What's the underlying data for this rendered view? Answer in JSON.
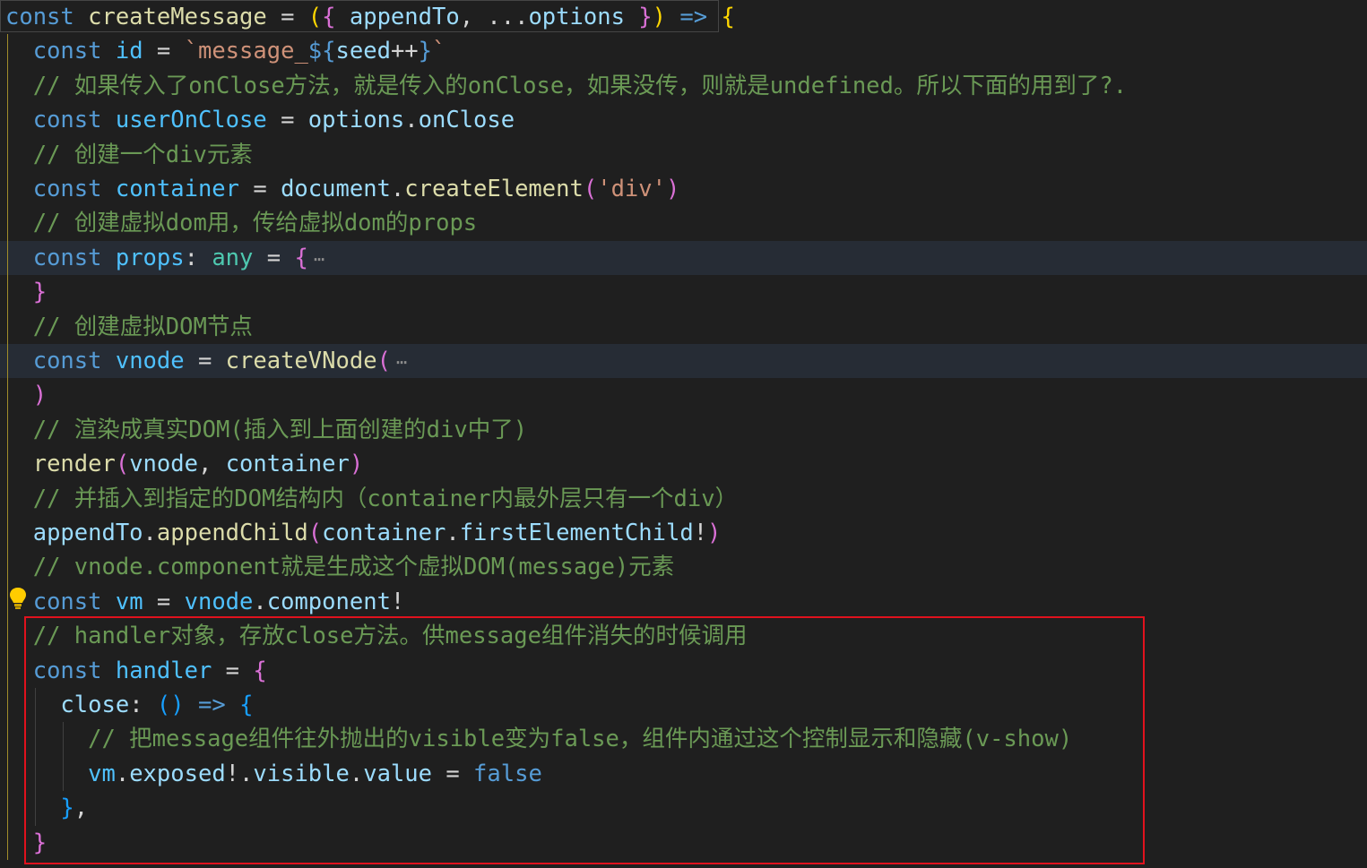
{
  "editor": {
    "lines": [
      {
        "tokens": [
          [
            "kw",
            "const"
          ],
          [
            "pun",
            " "
          ],
          [
            "fn",
            "createMessage"
          ],
          [
            "pun",
            " = "
          ],
          [
            "b1",
            "("
          ],
          [
            "b2",
            "{"
          ],
          [
            "pun",
            " "
          ],
          [
            "var",
            "appendTo"
          ],
          [
            "pun",
            ", ..."
          ],
          [
            "var",
            "options"
          ],
          [
            "pun",
            " "
          ],
          [
            "b2",
            "}"
          ],
          [
            "b1",
            ")"
          ],
          [
            "pun",
            " "
          ],
          [
            "kw",
            "=>"
          ],
          [
            "pun",
            " "
          ],
          [
            "b1",
            "{"
          ]
        ]
      },
      {
        "tokens": [
          [
            "pun",
            "  "
          ],
          [
            "kw",
            "const"
          ],
          [
            "pun",
            " "
          ],
          [
            "cst",
            "id"
          ],
          [
            "pun",
            " = "
          ],
          [
            "str",
            "`message_"
          ],
          [
            "kw",
            "${"
          ],
          [
            "var",
            "seed"
          ],
          [
            "pun",
            "++"
          ],
          [
            "kw",
            "}"
          ],
          [
            "str",
            "`"
          ]
        ]
      },
      {
        "tokens": [
          [
            "pun",
            "  "
          ],
          [
            "cmt",
            "// 如果传入了onClose方法，就是传入的onClose，如果没传，则就是undefined。所以下面的用到了?."
          ]
        ]
      },
      {
        "tokens": [
          [
            "pun",
            "  "
          ],
          [
            "kw",
            "const"
          ],
          [
            "pun",
            " "
          ],
          [
            "cst",
            "userOnClose"
          ],
          [
            "pun",
            " = "
          ],
          [
            "var",
            "options"
          ],
          [
            "pun",
            "."
          ],
          [
            "var",
            "onClose"
          ]
        ]
      },
      {
        "tokens": [
          [
            "pun",
            "  "
          ],
          [
            "cmt",
            "// 创建一个div元素"
          ]
        ]
      },
      {
        "tokens": [
          [
            "pun",
            "  "
          ],
          [
            "kw",
            "const"
          ],
          [
            "pun",
            " "
          ],
          [
            "cst",
            "container"
          ],
          [
            "pun",
            " = "
          ],
          [
            "var",
            "document"
          ],
          [
            "pun",
            "."
          ],
          [
            "fn",
            "createElement"
          ],
          [
            "b2",
            "("
          ],
          [
            "str",
            "'div'"
          ],
          [
            "b2",
            ")"
          ]
        ]
      },
      {
        "tokens": [
          [
            "pun",
            "  "
          ],
          [
            "cmt",
            "// 创建虚拟dom用，传给虚拟dom的props"
          ]
        ]
      },
      {
        "highlight": true,
        "fold": "⋯",
        "tokens": [
          [
            "pun",
            "  "
          ],
          [
            "kw",
            "const"
          ],
          [
            "pun",
            " "
          ],
          [
            "cst",
            "props"
          ],
          [
            "pun",
            ": "
          ],
          [
            "typ",
            "any"
          ],
          [
            "pun",
            " = "
          ],
          [
            "b2",
            "{"
          ]
        ]
      },
      {
        "tokens": [
          [
            "pun",
            "  "
          ],
          [
            "b2",
            "}"
          ]
        ]
      },
      {
        "tokens": [
          [
            "pun",
            "  "
          ],
          [
            "cmt",
            "// 创建虚拟DOM节点"
          ]
        ]
      },
      {
        "highlight": true,
        "fold": "⋯",
        "tokens": [
          [
            "pun",
            "  "
          ],
          [
            "kw",
            "const"
          ],
          [
            "pun",
            " "
          ],
          [
            "cst",
            "vnode"
          ],
          [
            "pun",
            " = "
          ],
          [
            "fn",
            "createVNode"
          ],
          [
            "b2",
            "("
          ]
        ]
      },
      {
        "tokens": [
          [
            "pun",
            "  "
          ],
          [
            "b2",
            ")"
          ]
        ]
      },
      {
        "tokens": [
          [
            "pun",
            "  "
          ],
          [
            "cmt",
            "// 渲染成真实DOM(插入到上面创建的div中了)"
          ]
        ]
      },
      {
        "tokens": [
          [
            "pun",
            "  "
          ],
          [
            "fn",
            "render"
          ],
          [
            "b2",
            "("
          ],
          [
            "var",
            "vnode"
          ],
          [
            "pun",
            ", "
          ],
          [
            "var",
            "container"
          ],
          [
            "b2",
            ")"
          ]
        ]
      },
      {
        "tokens": [
          [
            "pun",
            "  "
          ],
          [
            "cmt",
            "// 并插入到指定的DOM结构内（container内最外层只有一个div）"
          ]
        ]
      },
      {
        "tokens": [
          [
            "pun",
            "  "
          ],
          [
            "var",
            "appendTo"
          ],
          [
            "pun",
            "."
          ],
          [
            "fn",
            "appendChild"
          ],
          [
            "b2",
            "("
          ],
          [
            "var",
            "container"
          ],
          [
            "pun",
            "."
          ],
          [
            "var",
            "firstElementChild"
          ],
          [
            "pun",
            "!"
          ],
          [
            "b2",
            ")"
          ]
        ]
      },
      {
        "tokens": [
          [
            "pun",
            "  "
          ],
          [
            "cmt",
            "// vnode.component就是生成这个虚拟DOM(message)元素"
          ]
        ]
      },
      {
        "tokens": [
          [
            "pun",
            "  "
          ],
          [
            "kw",
            "const"
          ],
          [
            "pun",
            " "
          ],
          [
            "cst",
            "vm"
          ],
          [
            "pun",
            " = "
          ],
          [
            "cst",
            "vnode"
          ],
          [
            "pun",
            "."
          ],
          [
            "var",
            "component"
          ],
          [
            "pun",
            "!"
          ]
        ]
      },
      {
        "tokens": [
          [
            "pun",
            "  "
          ],
          [
            "cmt",
            "// handler对象，存放close方法。供message组件消失的时候调用"
          ]
        ]
      },
      {
        "tokens": [
          [
            "pun",
            "  "
          ],
          [
            "kw",
            "const"
          ],
          [
            "pun",
            " "
          ],
          [
            "cst",
            "handler"
          ],
          [
            "pun",
            " = "
          ],
          [
            "b2",
            "{"
          ]
        ]
      },
      {
        "tokens": [
          [
            "pun",
            "    "
          ],
          [
            "var",
            "close"
          ],
          [
            "pun",
            ": "
          ],
          [
            "b3",
            "()"
          ],
          [
            "pun",
            " "
          ],
          [
            "kw",
            "=>"
          ],
          [
            "pun",
            " "
          ],
          [
            "b3",
            "{"
          ]
        ]
      },
      {
        "tokens": [
          [
            "pun",
            "      "
          ],
          [
            "cmt",
            "// 把message组件往外抛出的visible变为false，组件内通过这个控制显示和隐藏(v-show)"
          ]
        ]
      },
      {
        "tokens": [
          [
            "pun",
            "      "
          ],
          [
            "cst",
            "vm"
          ],
          [
            "pun",
            "."
          ],
          [
            "var",
            "exposed"
          ],
          [
            "pun",
            "!."
          ],
          [
            "var",
            "visible"
          ],
          [
            "pun",
            "."
          ],
          [
            "var",
            "value"
          ],
          [
            "pun",
            " = "
          ],
          [
            "kw",
            "false"
          ]
        ]
      },
      {
        "tokens": [
          [
            "pun",
            "    "
          ],
          [
            "b3",
            "}"
          ],
          [
            "pun",
            ","
          ]
        ]
      },
      {
        "tokens": [
          [
            "pun",
            "  "
          ],
          [
            "b2",
            "}"
          ]
        ]
      }
    ]
  },
  "colors": {
    "background": "#1f1f1f",
    "keyword": "#569cd6",
    "variable": "#9cdcfe",
    "constant": "#4fc1ff",
    "function": "#dcdcaa",
    "string": "#ce9178",
    "comment": "#6a9955",
    "bracket_1": "#ffd700",
    "bracket_2": "#da70d6",
    "bracket_3": "#179fff",
    "annotation_box": "#e0121d"
  },
  "icons": {
    "lightbulb": "lightbulb-icon",
    "fold": "fold-ellipsis-icon"
  }
}
